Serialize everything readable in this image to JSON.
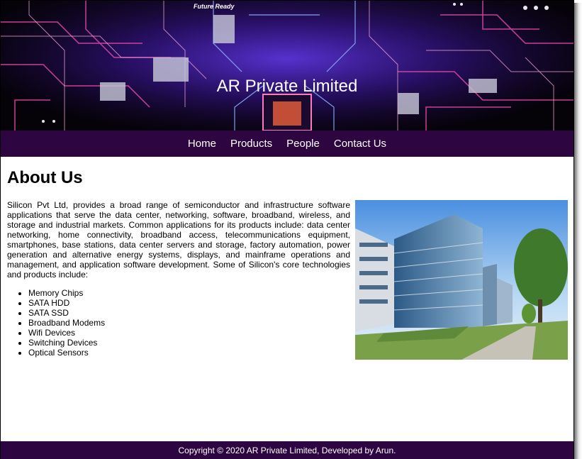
{
  "header": {
    "badge": "Future Ready",
    "title": "AR Private Limited"
  },
  "nav": {
    "items": [
      "Home",
      "Products",
      "People",
      "Contact Us"
    ]
  },
  "main": {
    "heading": "About Us",
    "paragraph": "Silicon Pvt Ltd, provides a broad range of semiconductor and infrastructure software applications that serve the data center, networking, software, broadband, wireless, and storage and industrial markets. Common applications for its products include: data center networking, home connectivity, broadband access, telecommunications equipment, smartphones, base stations, data center servers and storage, factory automation, power generation and alternative energy systems, displays, and mainframe operations and management, and application software development. Some of Silicon's core technologies and products include:",
    "list": [
      "Memory Chips",
      "SATA HDD",
      "SATA SSD",
      "Broadband Modems",
      "Wifi Devices",
      "Switching Devices",
      "Optical Sensors"
    ]
  },
  "footer": {
    "text": "Copyright © 2020 AR Private Limited, Developed by Arun."
  },
  "colors": {
    "nav_bg": "#2d0540",
    "footer_bg": "#2d0540",
    "text": "#000000"
  },
  "icons": {
    "banner": "circuit-board-image",
    "building": "office-building-photo"
  }
}
